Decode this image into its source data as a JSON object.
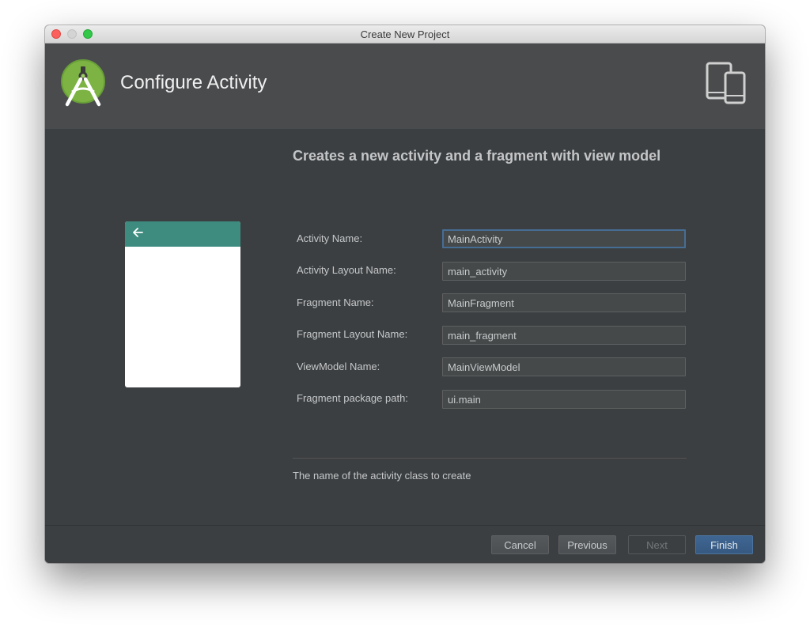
{
  "window": {
    "title": "Create New Project"
  },
  "header": {
    "title": "Configure Activity",
    "logo_icon": "android-studio-logo-icon",
    "device_icon": "tablet-phone-devices-icon"
  },
  "preview": {
    "back_icon": "arrow-left-icon",
    "toolbar_color": "#3e8c7f"
  },
  "main": {
    "description": "Creates a new activity and a fragment with view model",
    "fields": [
      {
        "label": "Activity Name:",
        "value": "MainActivity"
      },
      {
        "label": "Activity Layout Name:",
        "value": "main_activity"
      },
      {
        "label": "Fragment Name:",
        "value": "MainFragment"
      },
      {
        "label": "Fragment Layout Name:",
        "value": "main_fragment"
      },
      {
        "label": "ViewModel Name:",
        "value": "MainViewModel"
      },
      {
        "label": "Fragment package path:",
        "value": "ui.main"
      }
    ],
    "hint": "The name of the activity class to create"
  },
  "footer": {
    "cancel_label": "Cancel",
    "previous_label": "Previous",
    "next_label": "Next",
    "finish_label": "Finish"
  },
  "colors": {
    "accent": "#466d94",
    "primary_button": "#3f6693",
    "android_green": "#7cb342"
  }
}
